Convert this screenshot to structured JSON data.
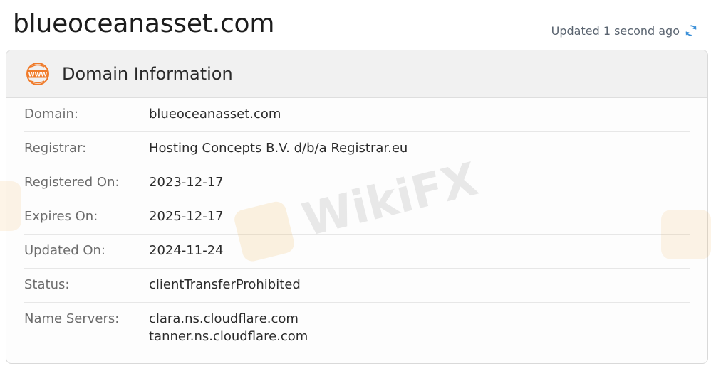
{
  "header": {
    "domain": "blueoceanasset.com",
    "updated_text": "Updated 1 second ago",
    "refresh_icon": "refresh-icon"
  },
  "card": {
    "icon": "www-icon",
    "icon_text": "WWW",
    "title": "Domain Information",
    "rows": [
      {
        "label": "Domain:",
        "value": "blueoceanasset.com"
      },
      {
        "label": "Registrar:",
        "value": "Hosting Concepts B.V. d/b/a Registrar.eu"
      },
      {
        "label": "Registered On:",
        "value": "2023-12-17"
      },
      {
        "label": "Expires On:",
        "value": "2025-12-17"
      },
      {
        "label": "Updated On:",
        "value": "2024-11-24"
      },
      {
        "label": "Status:",
        "value": "clientTransferProhibited"
      },
      {
        "label": "Name Servers:",
        "values": [
          "clara.ns.cloudflare.com",
          "tanner.ns.cloudflare.com"
        ]
      }
    ]
  },
  "watermark": {
    "text": "WikiFX"
  },
  "colors": {
    "accent_orange": "#f07b2a",
    "refresh_blue": "#3a8fd8",
    "header_bg": "#f1f1f1"
  }
}
